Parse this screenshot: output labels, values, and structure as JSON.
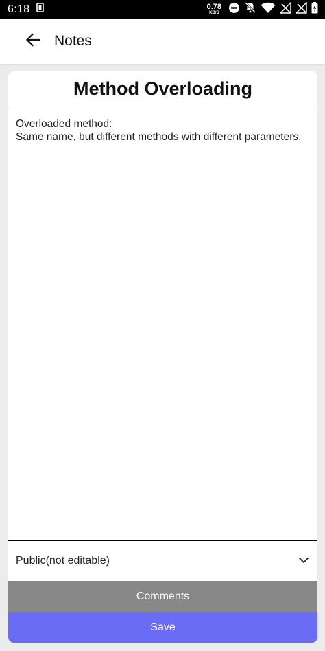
{
  "status_bar": {
    "time": "6:18",
    "net_speed_value": "0.78",
    "net_speed_unit": "KB/S",
    "icons": [
      "sim-icon",
      "dnd-icon",
      "mute-icon",
      "wifi-icon",
      "signal-off-icon",
      "signal-off-icon",
      "battery-charging-icon"
    ]
  },
  "app_bar": {
    "title": "Notes",
    "back_icon": "arrow-left-icon"
  },
  "note": {
    "title": "Method Overloading",
    "body": "Overloaded method:\nSame name, but different methods with different parameters."
  },
  "visibility": {
    "selected": "Public(not editable)",
    "icon": "chevron-down-icon"
  },
  "buttons": {
    "comments_label": "Comments",
    "save_label": "Save"
  },
  "colors": {
    "comments_button": "#888888",
    "save_button": "#6a6cf6",
    "background": "#ececec"
  }
}
